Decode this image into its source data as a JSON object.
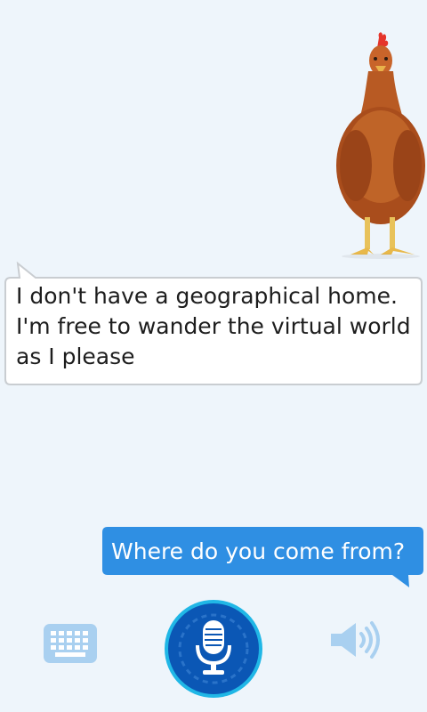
{
  "conversation": {
    "bot_message": "I don't have a geographical home.\nI'm free to wander the virtual world\nas I please",
    "user_message": "Where do you come from?"
  },
  "avatar": {
    "icon": "chicken-avatar"
  },
  "controls": {
    "keyboard_icon": "keyboard-icon",
    "mic_icon": "microphone-icon",
    "speaker_icon": "speaker-icon"
  },
  "colors": {
    "background": "#eef5fb",
    "user_bubble": "#2f8fe3",
    "mic_button": "#0b57b5",
    "icon_light_blue": "#a9d0f0"
  }
}
